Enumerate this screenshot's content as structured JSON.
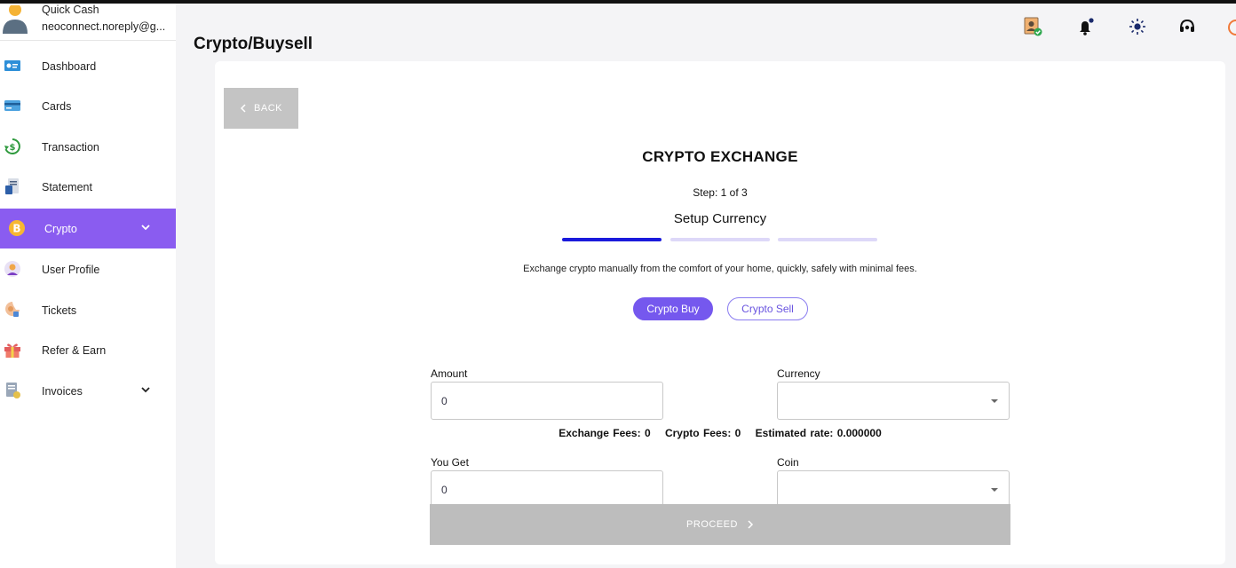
{
  "user": {
    "name": "Quick Cash",
    "email": "neoconnect.noreply@g..."
  },
  "sidebar": {
    "items": [
      {
        "label": "Dashboard",
        "icon": "dashboard-icon"
      },
      {
        "label": "Cards",
        "icon": "card-icon"
      },
      {
        "label": "Transaction",
        "icon": "transaction-icon"
      },
      {
        "label": "Statement",
        "icon": "statement-icon"
      },
      {
        "label": "Crypto",
        "icon": "bitcoin-icon",
        "active": true,
        "expandable": true
      },
      {
        "label": "User Profile",
        "icon": "user-profile-icon"
      },
      {
        "label": "Tickets",
        "icon": "tickets-icon"
      },
      {
        "label": "Refer & Earn",
        "icon": "gift-icon"
      },
      {
        "label": "Invoices",
        "icon": "invoice-icon",
        "expandable": true
      }
    ]
  },
  "header": {
    "title": "Crypto/Buysell",
    "icons": [
      "kyc-verified-icon",
      "notification-bell-icon",
      "theme-sun-icon",
      "support-headset-icon",
      "power-icon"
    ]
  },
  "main": {
    "back_label": "BACK",
    "title": "CRYPTO EXCHANGE",
    "step_text": "Step: 1 of 3",
    "step_name": "Setup Currency",
    "progress": {
      "current_step": 1,
      "total_steps": 3
    },
    "description": "Exchange crypto manually from the comfort of your home, quickly, safely with minimal fees.",
    "toggle": {
      "buy_label": "Crypto Buy",
      "sell_label": "Crypto Sell",
      "selected": "buy"
    },
    "amount": {
      "label": "Amount",
      "value": "0"
    },
    "currency": {
      "label": "Currency",
      "value": ""
    },
    "fees": {
      "exchange": "Exchange Fees: 0",
      "crypto": "Crypto Fees: 0",
      "rate": "Estimated rate: 0.000000"
    },
    "you_get": {
      "label": "You Get",
      "value": "0"
    },
    "coin": {
      "label": "Coin",
      "value": ""
    },
    "proceed_label": "PROCEED"
  },
  "colors": {
    "accent": "#7558ee",
    "sidebar_active": "#8a5cf0",
    "progress_active": "#1a1adb",
    "progress_inactive": "#ddd8f8",
    "disabled_button": "#bdbdbd"
  }
}
